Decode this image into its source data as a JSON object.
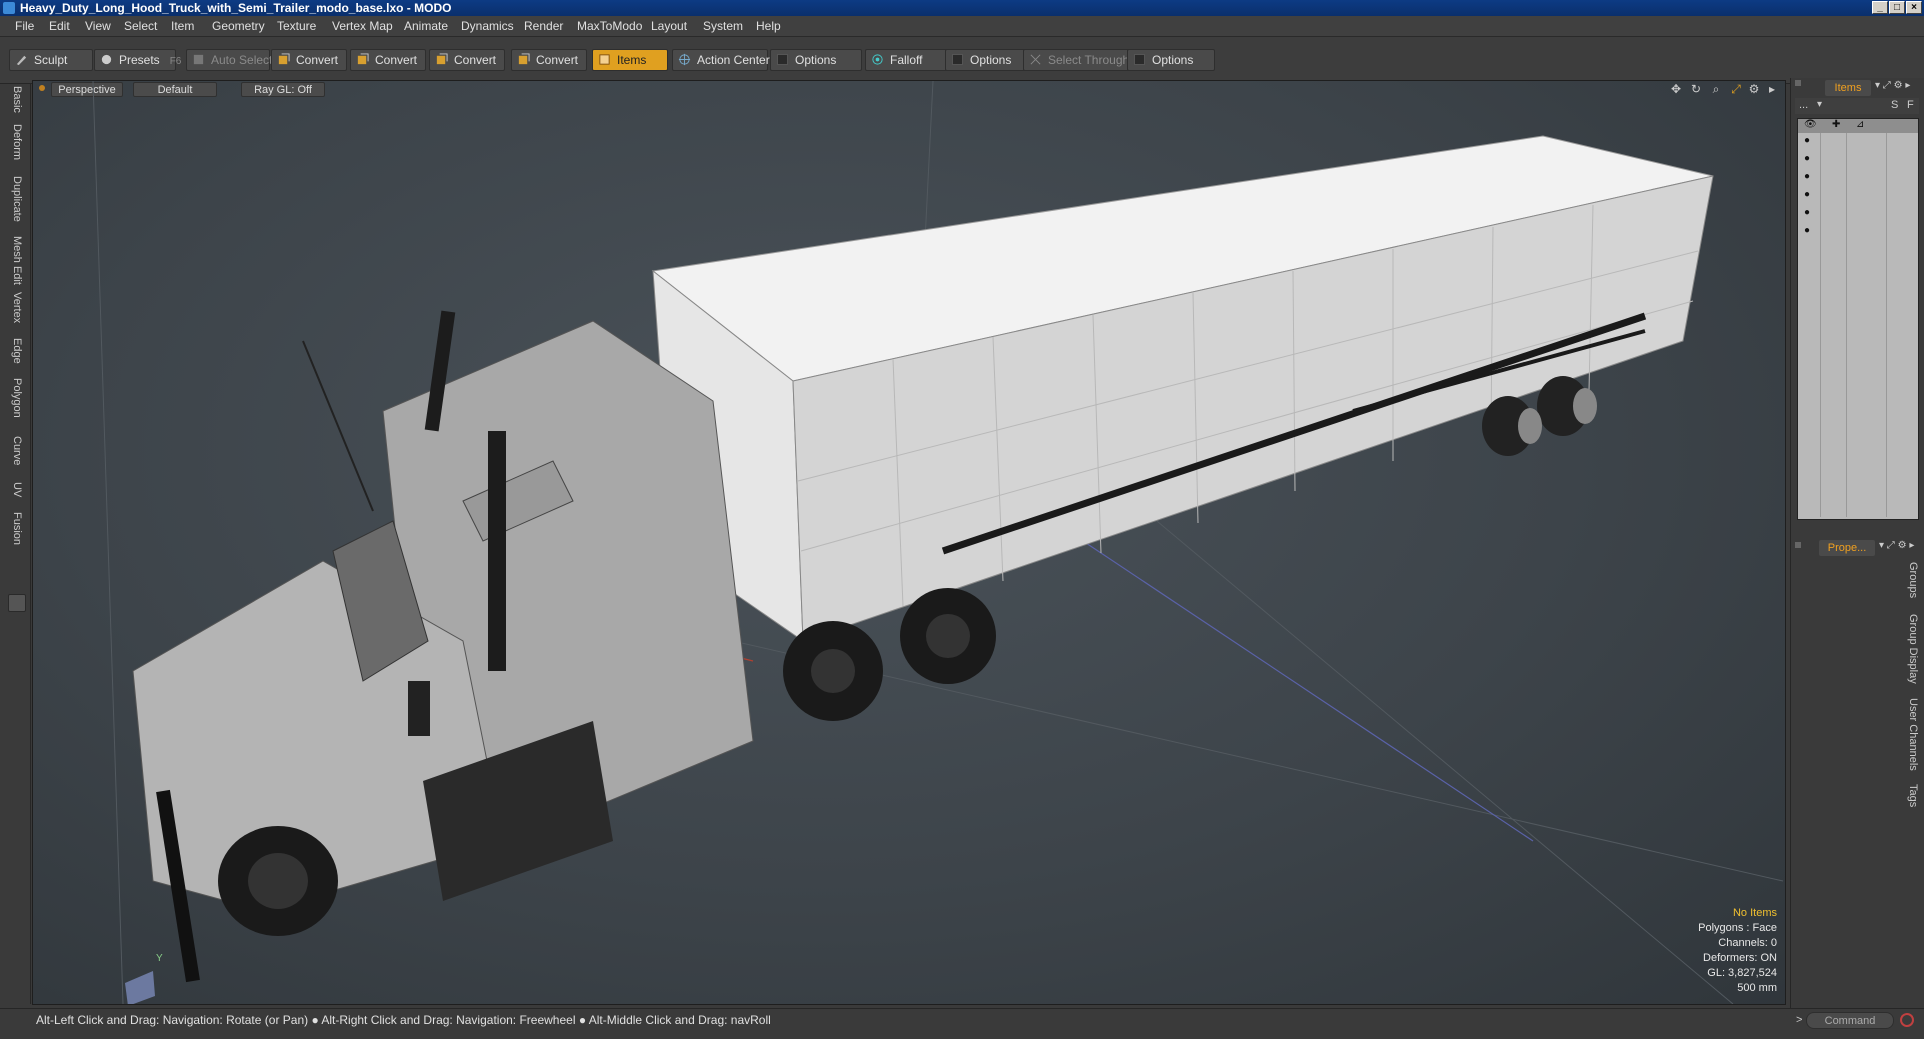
{
  "window": {
    "title": "Heavy_Duty_Long_Hood_Truck_with_Semi_Trailer_modo_base.lxo - MODO",
    "min": "_",
    "max": "□",
    "close": "×"
  },
  "menu": [
    "File",
    "Edit",
    "View",
    "Select",
    "Item",
    "Geometry",
    "Texture",
    "Vertex Map",
    "Animate",
    "Dynamics",
    "Render",
    "MaxToModo",
    "Layout",
    "System",
    "Help"
  ],
  "toolbar": {
    "sculpt": "Sculpt",
    "presets": "Presets",
    "presets_key": "F6",
    "auto_select": "Auto Select",
    "convert": "Convert",
    "items": "Items",
    "action_center": "Action Center",
    "options": "Options",
    "falloff": "Falloff",
    "select_through": "Select Through"
  },
  "left_tabs": [
    "Basic",
    "Deform",
    "Duplicate",
    "Mesh Edit",
    "Vertex",
    "Edge",
    "Polygon",
    "Curve",
    "UV",
    "Fusion"
  ],
  "viewport": {
    "view": "Perspective",
    "shading": "Default",
    "raygl": "Ray GL: Off",
    "axis_label": "Y",
    "stats": {
      "selection": "No Items",
      "polygons": "Polygons : Face",
      "channels": "Channels: 0",
      "deformers": "Deformers: ON",
      "gl": "GL: 3,827,524",
      "scale": "500 mm"
    }
  },
  "right_panel": {
    "items_tab": "Items",
    "properties_tab": "Prope...",
    "s_btn": "S",
    "f_btn": "F",
    "dots": "...",
    "side_tabs": [
      "Groups",
      "Group Display",
      "User Channels",
      "Tags"
    ]
  },
  "status": {
    "hint": "Alt-Left Click and Drag: Navigation: Rotate (or Pan) ● Alt-Right Click and Drag: Navigation: Freewheel ● Alt-Middle Click and Drag: navRoll",
    "command_placeholder": "Command",
    "prompt": ">"
  },
  "colors": {
    "accent": "#e0a020",
    "title_bar": "#0d3b84",
    "viewport_bg": "#3d444a"
  }
}
